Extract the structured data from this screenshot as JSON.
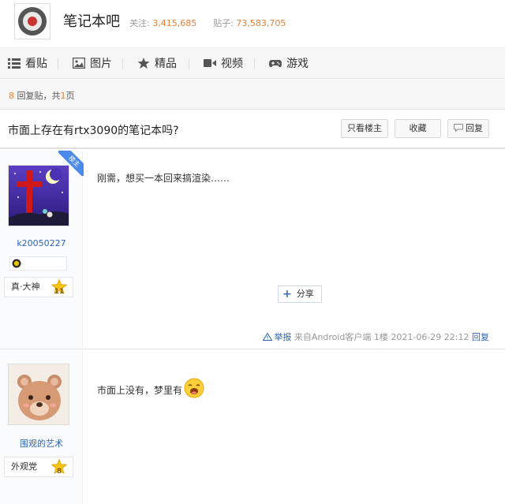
{
  "forum": {
    "name": "笔记本吧",
    "followers_label": "关注:",
    "followers_count": "3,415,685",
    "posts_label": "贴子:",
    "posts_count": "73,583,705"
  },
  "nav": {
    "items": [
      {
        "label": "看贴",
        "icon": "list-icon"
      },
      {
        "label": "图片",
        "icon": "image-icon"
      },
      {
        "label": "精品",
        "icon": "star-icon"
      },
      {
        "label": "视频",
        "icon": "video-icon"
      },
      {
        "label": "游戏",
        "icon": "gamepad-icon"
      }
    ]
  },
  "reply_count": {
    "count": "8",
    "label_mid": "回复贴，共",
    "pages": "1",
    "label_end": "页"
  },
  "thread": {
    "title": "市面上存在有rtx3090的笔记本吗?",
    "only_op_label": "只看楼主",
    "favorite_label": "收藏",
    "reply_label": "回复"
  },
  "posts": [
    {
      "username": "k20050227",
      "op_badge": "楼主",
      "level_title": "真·大神",
      "level_num": "11",
      "content": "刚需，想买一本回来搞渲染……",
      "share_label": "分享",
      "report_label": "举报",
      "source": "来自Android客户端",
      "floor": "1楼",
      "timestamp": "2021-06-29 22:12",
      "reply_label": "回复"
    },
    {
      "username": "围观的艺术",
      "level_title": "外观党",
      "level_num": "8",
      "content": "市面上没有，梦里有"
    }
  ],
  "colors": {
    "accent_orange": "#e67f39",
    "link_blue": "#2d64b3",
    "op_ribbon": "#4a8ae8"
  }
}
